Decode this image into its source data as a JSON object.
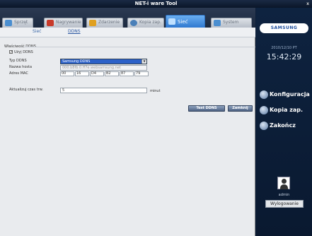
{
  "window": {
    "title": "NET-i ware Tool",
    "close_glyph": "x"
  },
  "tabs": [
    {
      "label": "Sprzęt",
      "icon": "monitor-icon",
      "color": "#4a8ed0"
    },
    {
      "label": "Nagrywanie",
      "icon": "record-icon",
      "color": "#c83a2a"
    },
    {
      "label": "Zdarzenie",
      "icon": "bell-icon",
      "color": "#e0a020"
    },
    {
      "label": "Kopia zap.",
      "icon": "backup-icon",
      "color": "#4a7fb8"
    },
    {
      "label": "Sieć",
      "icon": "network-icon",
      "color": "#ffffff"
    },
    {
      "label": "System",
      "icon": "system-icon",
      "color": "#4a8ed0"
    }
  ],
  "active_tab": "Sieć",
  "subnav": {
    "items": [
      "Sieć",
      "DDNS"
    ],
    "active": "DDNS"
  },
  "ddns": {
    "group_label": "Właściwość DDNS",
    "use_ddns_label": "Użyj DDNS",
    "use_ddns_checked": true,
    "type_label": "Typ DDNS",
    "type_value": "Samsung DDNS",
    "host_label": "Nazwa hosta",
    "host_value": "000.b8fb.0.ff7e.websamsung.net",
    "mac_label": "Adres MAC",
    "mac_values": [
      "00",
      "16",
      "D4",
      "B2",
      "87",
      "79"
    ],
    "interval_label": "Aktualizuj czas trw.",
    "interval_value": "5",
    "interval_unit": "minut"
  },
  "buttons": {
    "test": "Test DDNS",
    "close": "Zamknij"
  },
  "sidebar": {
    "brand": "SAMSUNG",
    "date": "2010/12/10  PT",
    "time": "15:42:29",
    "menu": [
      {
        "label": "Konfiguracja",
        "icon": "gear-icon"
      },
      {
        "label": "Kopia zap.",
        "icon": "backup-icon"
      },
      {
        "label": "Zakończ",
        "icon": "power-icon"
      }
    ],
    "user": "admin",
    "logout": "Wylogowanie"
  }
}
